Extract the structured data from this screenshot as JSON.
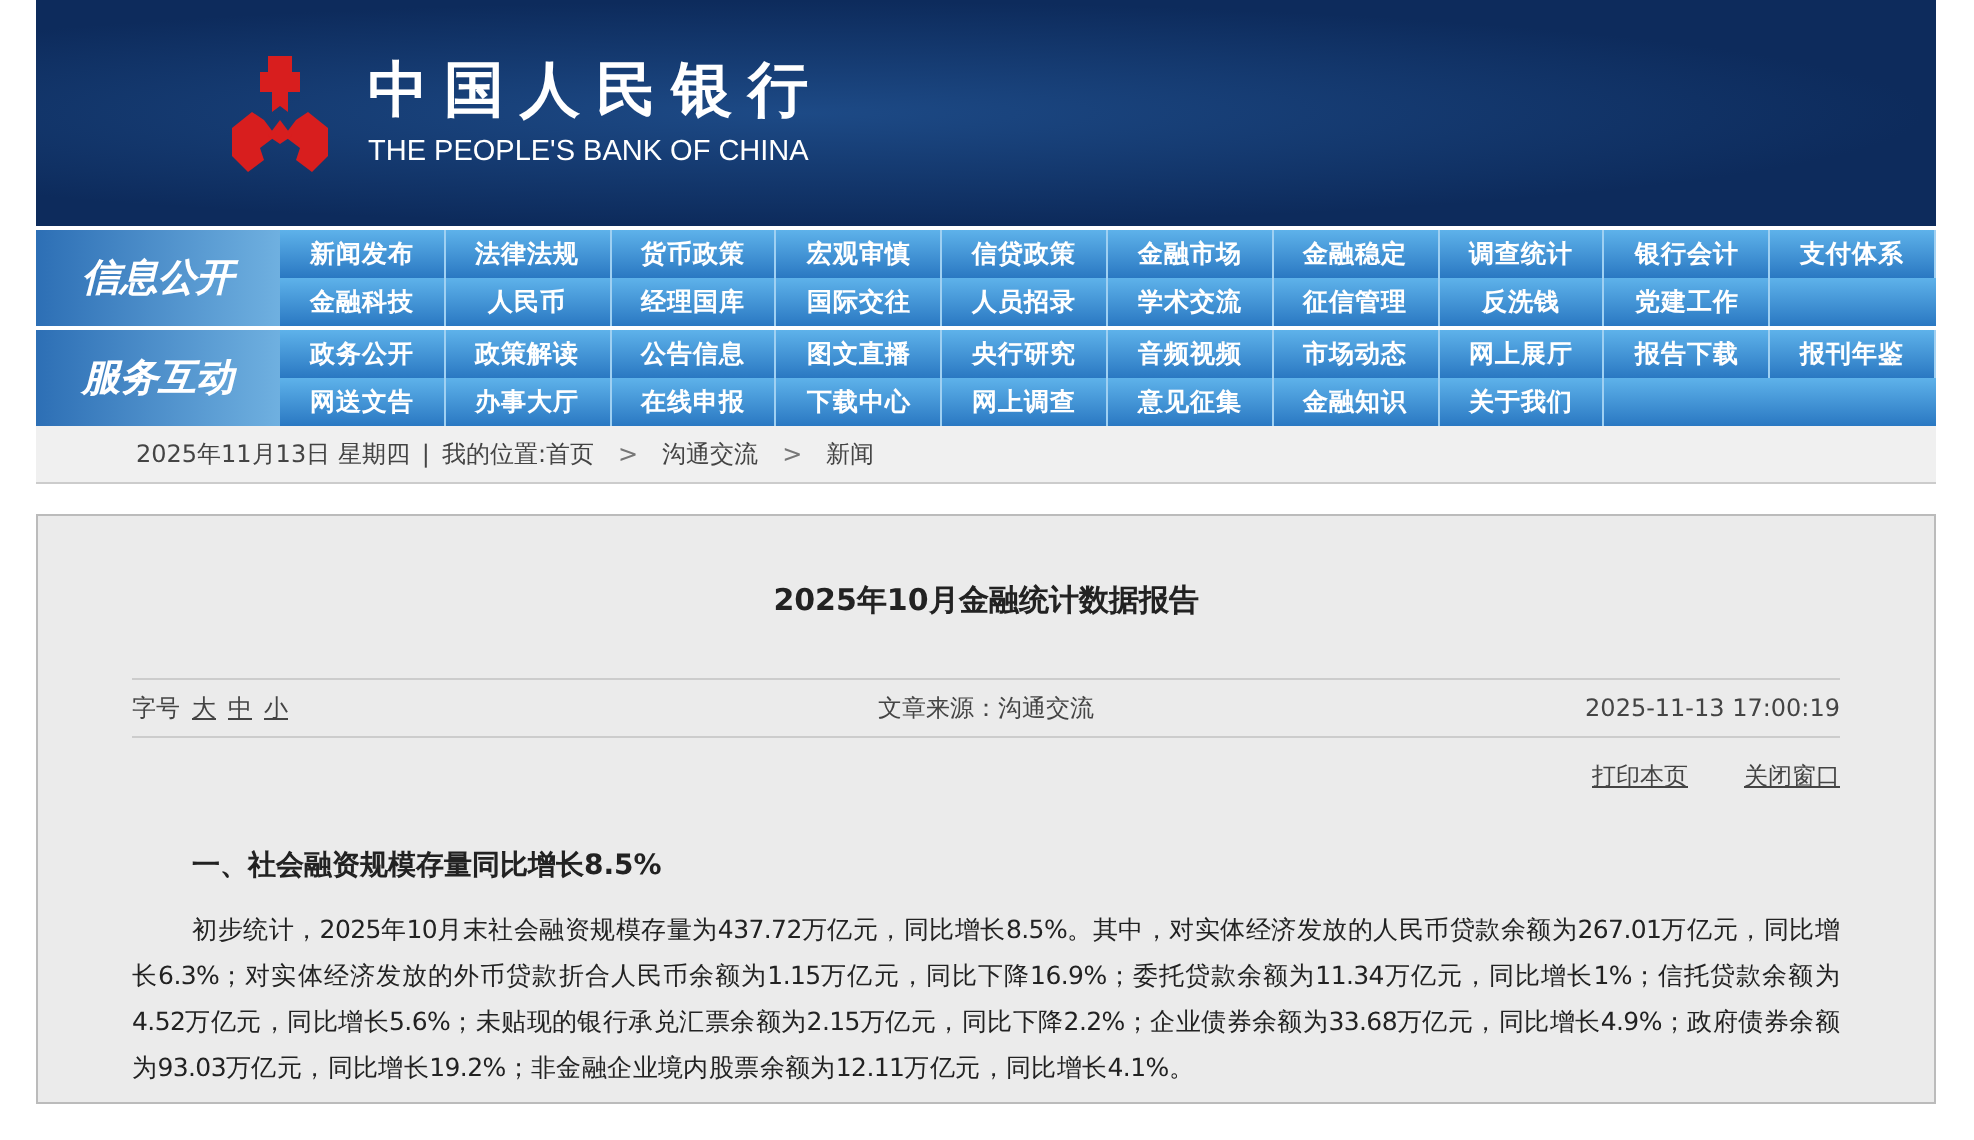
{
  "header": {
    "logo_cn": "中国人民银行",
    "logo_en": "THE PEOPLE'S BANK OF CHINA"
  },
  "nav_groups": [
    {
      "label": "信息公开",
      "rows": [
        [
          "新闻发布",
          "法律法规",
          "货币政策",
          "宏观审慎",
          "信贷政策",
          "金融市场",
          "金融稳定",
          "调查统计",
          "银行会计",
          "支付体系"
        ],
        [
          "金融科技",
          "人民币",
          "经理国库",
          "国际交往",
          "人员招录",
          "学术交流",
          "征信管理",
          "反洗钱",
          "党建工作"
        ]
      ]
    },
    {
      "label": "服务互动",
      "rows": [
        [
          "政务公开",
          "政策解读",
          "公告信息",
          "图文直播",
          "央行研究",
          "音频视频",
          "市场动态",
          "网上展厅",
          "报告下载",
          "报刊年鉴"
        ],
        [
          "网送文告",
          "办事大厅",
          "在线申报",
          "下载中心",
          "网上调查",
          "意见征集",
          "金融知识",
          "关于我们"
        ]
      ]
    }
  ],
  "breadcrumb": {
    "date": "2025年11月13日 星期四",
    "separator": "|",
    "items": [
      "我的位置:首页",
      "沟通交流",
      "新闻"
    ],
    "arrow": ">"
  },
  "article": {
    "title": "2025年10月金融统计数据报告",
    "font_size": {
      "label": "字号",
      "options": [
        "大",
        "中",
        "小"
      ]
    },
    "source": "文章来源：沟通交流",
    "datetime": "2025-11-13 17:00:19",
    "actions": [
      "打印本页",
      "关闭窗口"
    ],
    "heading": "一、社会融资规模存量同比增长8.5%",
    "paragraph": "初步统计，2025年10月末社会融资规模存量为437.72万亿元，同比增长8.5%。其中，对实体经济发放的人民币贷款余额为267.01万亿元，同比增长6.3%；对实体经济发放的外币贷款折合人民币余额为1.15万亿元，同比下降16.9%；委托贷款余额为11.34万亿元，同比增长1%；信托贷款余额为4.52万亿元，同比增长5.6%；未贴现的银行承兑汇票余额为2.15万亿元，同比下降2.2%；企业债券余额为33.68万亿元，同比增长4.9%；政府债券余额为93.03万亿元，同比增长19.2%；非金融企业境内股票余额为12.11万亿元，同比增长4.1%。"
  }
}
